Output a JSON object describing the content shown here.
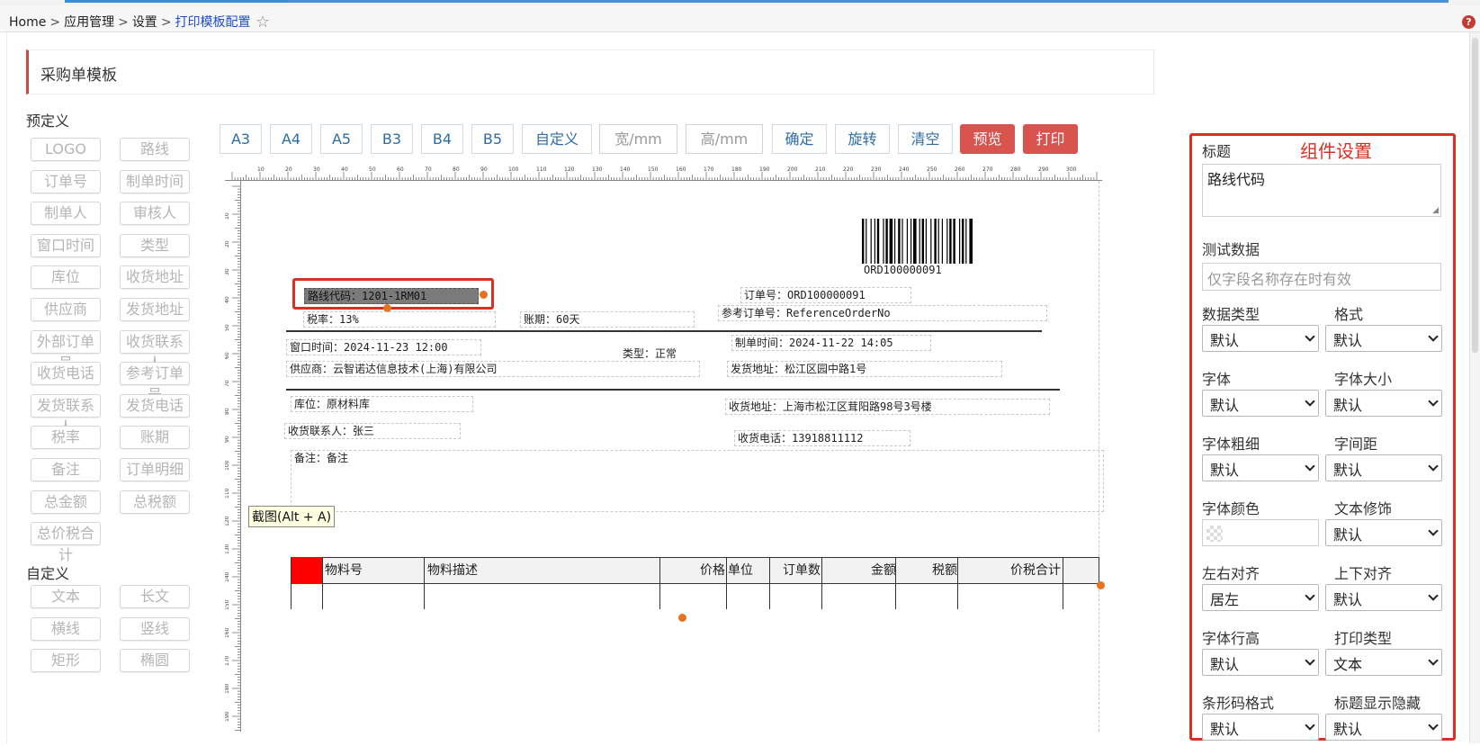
{
  "breadcrumb": {
    "home": "Home",
    "sep": ">",
    "items": [
      "应用管理",
      "设置"
    ],
    "current": "打印模板配置"
  },
  "panel": {
    "title": "采购单模板"
  },
  "palette": {
    "predefined_title": "预定义",
    "predefined": [
      "LOGO",
      "路线",
      "订单号",
      "制单时间",
      "制单人",
      "审核人",
      "窗口时间",
      "类型",
      "库位",
      "收货地址",
      "供应商",
      "发货地址",
      "外部订单号",
      "收货联系人",
      "收货电话",
      "参考订单号",
      "发货联系人",
      "发货电话",
      "税率",
      "账期",
      "备注",
      "订单明细",
      "总金额",
      "总税额",
      "总价税合计"
    ],
    "custom_title": "自定义",
    "custom": [
      "文本",
      "长文",
      "横线",
      "竖线",
      "矩形",
      "椭圆"
    ]
  },
  "toolbar": {
    "sizes": [
      "A3",
      "A4",
      "A5",
      "B3",
      "B4",
      "B5",
      "自定义"
    ],
    "width_placeholder": "宽/mm",
    "height_placeholder": "高/mm",
    "confirm": "确定",
    "rotate": "旋转",
    "clear": "清空",
    "preview": "预览",
    "print": "打印"
  },
  "ruler": {
    "top_labels": [
      "10",
      "20",
      "30",
      "40",
      "50",
      "60",
      "70",
      "80",
      "90",
      "100",
      "110",
      "120",
      "130",
      "140",
      "150",
      "160",
      "170",
      "180",
      "190",
      "200",
      "210",
      "220",
      "230",
      "240",
      "250",
      "260",
      "270",
      "280",
      "290",
      "300"
    ],
    "left_labels": [
      "10",
      "20",
      "30",
      "40",
      "50",
      "60",
      "70",
      "80",
      "90",
      "100",
      "110",
      "120",
      "130",
      "140",
      "150",
      "160",
      "170",
      "180",
      "190"
    ]
  },
  "template": {
    "barcode_text": "ORD100000091",
    "route": "路线代码：1201-1RM01",
    "order_no": "订单号：ORD100000091",
    "tax_rate": "税率：13%",
    "period": "账期：60天",
    "ref_order": "参考订单号：ReferenceOrderNo",
    "window_time": "窗口时间：2024-11-23 12:00",
    "type": "类型：正常",
    "create_time": "制单时间：2024-11-22 14:05",
    "supplier": "供应商：云智诺达信息技术(上海)有限公司",
    "ship_addr": "发货地址：松江区园中路1号",
    "location": "库位：原材料库",
    "recv_addr": "收货地址：上海市松江区茸阳路98号3号楼",
    "recv_contact": "收货联系人：张三",
    "recv_phone": "收货电话：13918811112",
    "remark": "备注：备注",
    "table_headers": [
      "物料号",
      "物料描述",
      "价格",
      "单位",
      "订单数",
      "金额",
      "税额",
      "价税合计"
    ]
  },
  "tooltip": "截图(Alt + A)",
  "settings": {
    "title": "组件设置",
    "label_title": "标题",
    "title_value": "路线代码",
    "label_test": "测试数据",
    "test_placeholder": "仅字段名称存在时有效",
    "rows": [
      {
        "l1": "数据类型",
        "v1": "默认",
        "l2": "格式",
        "v2": "默认"
      },
      {
        "l1": "字体",
        "v1": "默认",
        "l2": "字体大小",
        "v2": "默认"
      },
      {
        "l1": "字体粗细",
        "v1": "默认",
        "l2": "字间距",
        "v2": "默认"
      },
      {
        "l1": "字体颜色",
        "v1": "",
        "l2": "文本修饰",
        "v2": "默认"
      },
      {
        "l1": "左右对齐",
        "v1": "居左",
        "l2": "上下对齐",
        "v2": "默认"
      },
      {
        "l1": "字体行高",
        "v1": "默认",
        "l2": "打印类型",
        "v2": "文本"
      },
      {
        "l1": "条形码格式",
        "v1": "默认",
        "l2": "标题显示隐藏",
        "v2": "默认"
      }
    ]
  },
  "colors": {
    "accent": "#d93025",
    "link": "#2e6ca5",
    "danger_button": "#d9534f",
    "handle": "#e8731e"
  }
}
